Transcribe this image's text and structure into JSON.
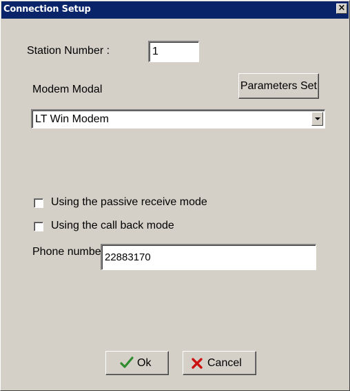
{
  "window": {
    "title": "Connection Setup",
    "close_glyph": "×"
  },
  "station": {
    "label": "Station Number :",
    "value": "1"
  },
  "modem": {
    "label": "Modem Modal",
    "parameters_button": "Parameters Set",
    "selected": "LT Win Modem"
  },
  "options": {
    "passive_receive": {
      "label": "Using the passive receive mode",
      "checked": false
    },
    "call_back": {
      "label": "Using the call back mode",
      "checked": false
    }
  },
  "phone": {
    "label": "Phone number",
    "value": "22883170"
  },
  "buttons": {
    "ok": "Ok",
    "cancel": "Cancel"
  },
  "icons": {
    "ok_icon": "check-icon",
    "cancel_icon": "x-icon"
  },
  "colors": {
    "titlebar": "#0a246a",
    "face": "#d4d0c8",
    "ok_check": "#2e8b2e",
    "cancel_x": "#cc1111"
  }
}
